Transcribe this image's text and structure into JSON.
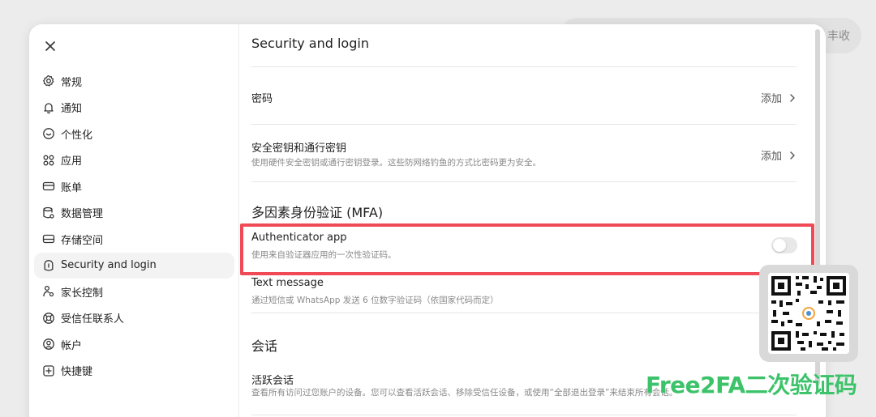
{
  "background": {
    "pill_text": "丰收"
  },
  "sidebar": {
    "close_icon": "close-icon",
    "items": [
      {
        "label": "常规",
        "icon": "gear-icon"
      },
      {
        "label": "通知",
        "icon": "bell-icon"
      },
      {
        "label": "个性化",
        "icon": "personalize-icon"
      },
      {
        "label": "应用",
        "icon": "apps-icon"
      },
      {
        "label": "账单",
        "icon": "card-icon"
      },
      {
        "label": "数据管理",
        "icon": "database-icon"
      },
      {
        "label": "存储空间",
        "icon": "storage-icon"
      },
      {
        "label": "Security and login",
        "icon": "lock-icon",
        "active": true
      },
      {
        "label": "家长控制",
        "icon": "parental-icon"
      },
      {
        "label": "受信任联系人",
        "icon": "lifebuoy-icon"
      },
      {
        "label": "帐户",
        "icon": "account-icon"
      },
      {
        "label": "快捷键",
        "icon": "shortcut-icon"
      }
    ]
  },
  "main": {
    "title": "Security and login",
    "password": {
      "title": "密码",
      "action": "添加"
    },
    "passkey": {
      "title": "安全密钥和通行密钥",
      "desc": "使用硬件安全密钥或通行密钥登录。这些防网络钓鱼的方式比密码更为安全。",
      "action": "添加"
    },
    "mfa": {
      "section_title": "多因素身份验证 (MFA)",
      "authenticator": {
        "title": "Authenticator app",
        "desc": "使用来自验证器应用的一次性验证码。",
        "enabled": false
      },
      "sms": {
        "title": "Text message",
        "desc": "通过短信或 WhatsApp 发送 6 位数字验证码（依国家代码而定）"
      }
    },
    "sessions": {
      "section_title": "会话",
      "active": {
        "title": "活跃会话",
        "desc": "查看所有访问过您账户的设备。您可以查看活跃会话、移除受信任设备，或使用“全部退出登录”来结束所有会话。"
      }
    }
  },
  "overlay": {
    "watermark": "Free2FA二次验证码",
    "highlight_color": "#ef4a55",
    "watermark_color": "#3cc36a"
  }
}
